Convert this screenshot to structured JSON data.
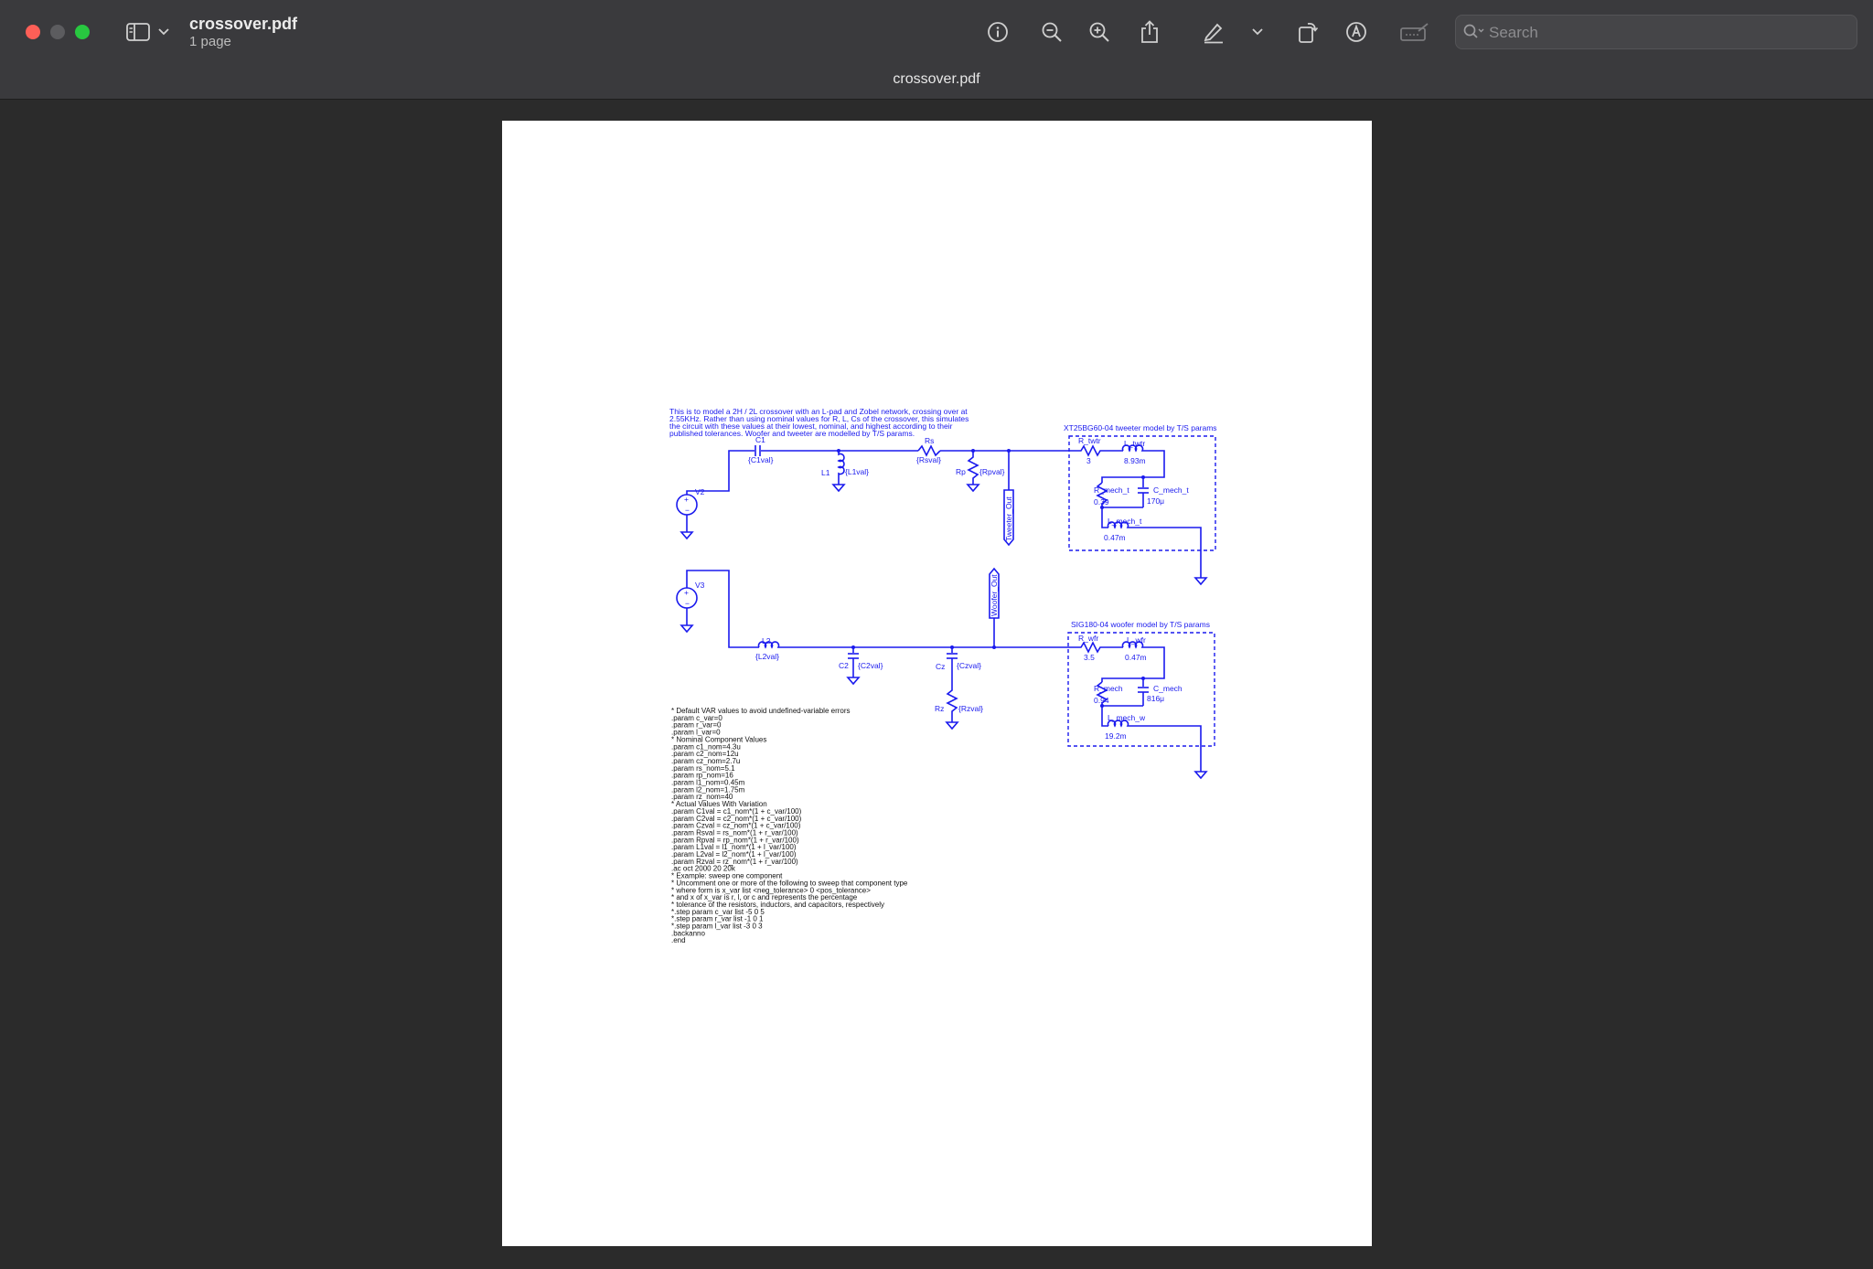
{
  "window": {
    "doc_title": "crossover.pdf",
    "page_count": "1 page",
    "tab_title": "crossover.pdf",
    "search_placeholder": "Search",
    "colors": {
      "toolbar": "#3a3a3d",
      "background": "#2b2b2b",
      "page": "#ffffff",
      "schematic_ink": "#1a1aee"
    }
  },
  "toolbar": {
    "icons": [
      "sidebar-icon",
      "chevron-down-icon",
      "info-icon",
      "zoom-out-icon",
      "zoom-in-icon",
      "share-icon",
      "highlight-pen-icon",
      "chevron-down-icon",
      "rotate-icon",
      "markup-icon",
      "signature-icon",
      "search-icon"
    ]
  },
  "schematic": {
    "description": [
      "This is to model a 2H / 2L crossover with an L-pad and Zobel network, crossing over at",
      " 2.55KHz.  Rather than using nominal values for R, L, Cs of the crossover, this simulates",
      " the circuit with these values at their lowest, nominal, and highest according to their",
      " published tolerances.  Woofer and tweeter are modelled by T/S params."
    ],
    "tweeter_box_title": "XT25BG60-04 tweeter model by T/S params",
    "woofer_box_title": "SIG180-04 woofer model by T/S params",
    "labels": {
      "c1": "C1",
      "c1_val": "{C1val}",
      "l1": "L1",
      "l1_val": "{L1val}",
      "rs": "Rs",
      "rs_val": "{Rsval}",
      "rp": "Rp",
      "rp_val": "{Rpval}",
      "v2": "V2",
      "v3": "V3",
      "l2": "L2",
      "l2_val": "{L2val}",
      "c2": "C2",
      "c2_val": "{C2val}",
      "cz": "Cz",
      "cz_val": "{Czval}",
      "rz": "Rz",
      "rz_val": "{Rzval}",
      "tweeter_out": "Tweeter_Out",
      "woofer_out": "Woofer_Out",
      "r_twtr": "R_twtr",
      "r_twtr_val": "3",
      "l_twtr": "L_twtr",
      "l_twtr_val": "8.93m",
      "r_mech_t": "R_mech_t",
      "r_mech_t_val": "0.39",
      "c_mech_t": "C_mech_t",
      "c_mech_t_val": "170μ",
      "l_mech_t": "L_mech_t",
      "l_mech_t_val": "0.47m",
      "r_wfr": "R_wfr",
      "r_wfr_val": "3.5",
      "l_wfr": "L_wfr",
      "l_wfr_val": "0.47m",
      "r_mech": "R_mech",
      "r_mech_val": "0.94",
      "c_mech": "C_mech",
      "c_mech_val": "816μ",
      "l_mech_w": "L_mech_w",
      "l_mech_w_val": "19.2m"
    },
    "directives": [
      "* Default VAR values to avoid undefined-variable errors",
      ".param c_var=0",
      ".param r_var=0",
      ".param l_var=0",
      "* Nominal Component Values",
      ".param c1_nom=4.3u",
      ".param c2_nom=12u",
      ".param cz_nom=2.7u",
      ".param rs_nom=5.1",
      ".param rp_nom=16",
      ".param l1_nom=0.45m",
      ".param l2_nom=1.75m",
      ".param rz_nom=40",
      "* Actual Values With Variation",
      ".param C1val = c1_nom*(1 + c_var/100)",
      ".param C2val = c2_nom*(1 + c_var/100)",
      ".param Czval = cz_nom*(1 + c_var/100)",
      ".param Rsval = rs_nom*(1 + r_var/100)",
      ".param Rpval = rp_nom*(1 + r_var/100)",
      ".param L1val = l1_nom*(1 + l_var/100)",
      ".param L2val = l2_nom*(1 + l_var/100)",
      ".param Rzval = rz_nom*(1 + r_var/100)",
      ".ac oct 2000 20 20k",
      "* Example: sweep one component",
      "* Uncomment one or more of the following to sweep that component type",
      "* where form is x_var list <neg_tolerance> 0 <pos_tolerance>",
      "* and x of x_var is r, l, or c and represents the percentage",
      "* tolerance of the resistors, inductors, and capacitors, respectively",
      "*.step param c_var list -5 0 5",
      "*.step param r_var list -1 0 1",
      "*.step param l_var list -3 0 3",
      ".backanno",
      ".end"
    ]
  }
}
